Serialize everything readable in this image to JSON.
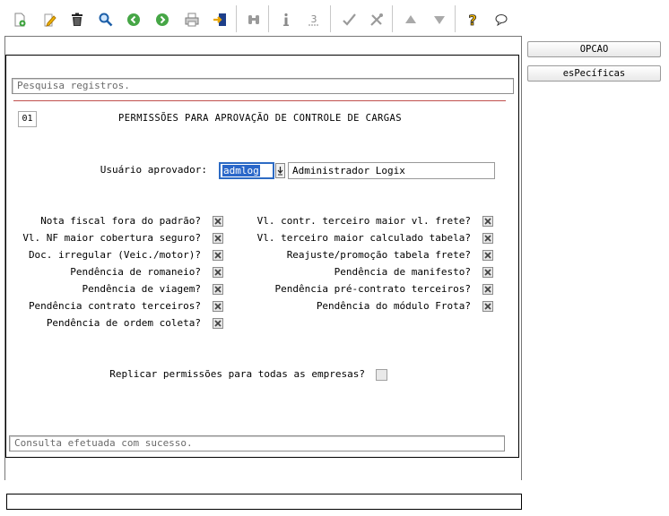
{
  "toolbar": {
    "icons": [
      "new-icon",
      "edit-icon",
      "trash-icon",
      "search-icon",
      "previous-icon",
      "next-icon",
      "print-icon",
      "exit-icon",
      "binoculars-icon",
      "info-icon",
      "count-icon",
      "check-icon",
      "tools-icon",
      "up-icon",
      "down-icon",
      "help-icon",
      "chat-icon"
    ],
    "count_glyph": "3"
  },
  "search": {
    "placeholder": "Pesquisa registros."
  },
  "form": {
    "number": "01",
    "title": "PERMISSÕES PARA APROVAÇÃO DE CONTROLE DE CARGAS",
    "user_label": "Usuário aprovador:",
    "user_code": "admlog",
    "user_name": "Administrador Logix",
    "left_permissions": [
      "Nota fiscal fora do padrão?",
      "Vl. NF maior cobertura seguro?",
      "Doc. irregular (Veic./motor)?",
      "Pendência de romaneio?",
      "Pendência de viagem?",
      "Pendência contrato terceiros?",
      "Pendência de ordem coleta?"
    ],
    "right_permissions": [
      "Vl. contr. terceiro maior vl. frete?",
      "Vl. terceiro maior calculado tabela?",
      "Reajuste/promoção tabela frete?",
      "Pendência de manifesto?",
      "Pendência pré-contrato terceiros?",
      "Pendência do módulo Frota?"
    ],
    "replicate_label": "Replicar permissões para todas as empresas?"
  },
  "status": {
    "message": "Consulta efetuada com sucesso."
  },
  "side": {
    "opcao_label": "OPCAO",
    "especificas_label": "esPecíficas"
  }
}
